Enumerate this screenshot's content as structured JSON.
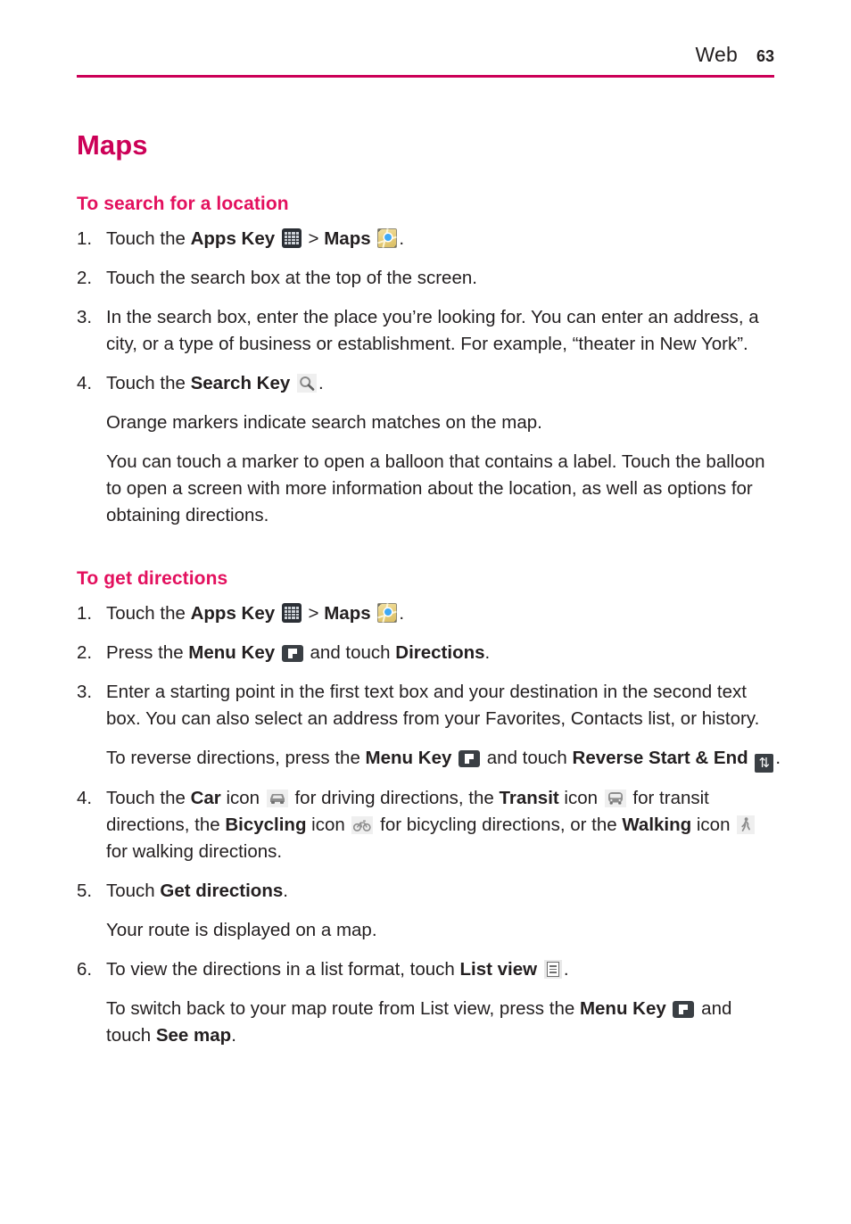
{
  "header": {
    "title": "Web",
    "page_number": "63",
    "rule_color": "#cc0057"
  },
  "colors": {
    "accent_magenta": "#cc0057",
    "subheading_magenta": "#e3105e",
    "body_text": "#231f20"
  },
  "section": {
    "title": "Maps"
  },
  "subsection_search": {
    "heading": "To search for a location",
    "steps": [
      {
        "num": "1.",
        "parts": [
          {
            "t": "Touch the "
          },
          {
            "t": "Apps Key",
            "b": true
          },
          {
            "t": " "
          },
          {
            "icon": "apps-key-icon"
          },
          {
            "t": " > "
          },
          {
            "t": "Maps",
            "b": true
          },
          {
            "t": " "
          },
          {
            "icon": "maps-app-icon"
          },
          {
            "t": "."
          }
        ]
      },
      {
        "num": "2.",
        "parts": [
          {
            "t": "Touch the search box at the top of the screen."
          }
        ]
      },
      {
        "num": "3.",
        "parts": [
          {
            "t": "In the search box, enter the place you’re looking for. You can enter an address, a city, or a type of business or establishment. For example, “theater in New York”."
          }
        ]
      },
      {
        "num": "4.",
        "parts": [
          {
            "t": "Touch the "
          },
          {
            "t": "Search Key",
            "b": true
          },
          {
            "t": " "
          },
          {
            "icon": "search-key-icon"
          },
          {
            "t": "."
          }
        ]
      }
    ],
    "note_1": "Orange markers indicate search matches on the map.",
    "note_2": "You can touch a marker to open a balloon that contains a label. Touch the balloon to open a screen with more information about the location, as well as options for obtaining directions."
  },
  "subsection_directions": {
    "heading": "To get directions",
    "steps": [
      {
        "num": "1.",
        "parts": [
          {
            "t": "Touch the "
          },
          {
            "t": "Apps Key",
            "b": true
          },
          {
            "t": " "
          },
          {
            "icon": "apps-key-icon"
          },
          {
            "t": " > "
          },
          {
            "t": "Maps",
            "b": true
          },
          {
            "t": " "
          },
          {
            "icon": "maps-app-icon"
          },
          {
            "t": "."
          }
        ]
      },
      {
        "num": "2.",
        "parts": [
          {
            "t": "Press the "
          },
          {
            "t": "Menu Key",
            "b": true
          },
          {
            "t": " "
          },
          {
            "icon": "menu-key-icon"
          },
          {
            "t": " and touch "
          },
          {
            "t": "Directions",
            "b": true
          },
          {
            "t": "."
          }
        ]
      },
      {
        "num": "3.",
        "parts": [
          {
            "t": "Enter a starting point in the first text box and your destination in the second text box. You can also select an address from your Favorites, Contacts list, or history."
          }
        ]
      },
      {
        "num": "4.",
        "parts": [
          {
            "t": "Touch the "
          },
          {
            "t": "Car",
            "b": true
          },
          {
            "t": " icon "
          },
          {
            "icon": "car-icon"
          },
          {
            "t": " for driving directions, the "
          },
          {
            "t": "Transit",
            "b": true
          },
          {
            "t": " icon "
          },
          {
            "icon": "transit-icon"
          },
          {
            "t": " for transit directions, the "
          },
          {
            "t": "Bicycling",
            "b": true
          },
          {
            "t": " icon "
          },
          {
            "icon": "bicycling-icon"
          },
          {
            "t": " for bicycling directions, or the "
          },
          {
            "t": "Walking",
            "b": true
          },
          {
            "t": " icon "
          },
          {
            "icon": "walking-icon"
          },
          {
            "t": " for walking directions."
          }
        ]
      },
      {
        "num": "5.",
        "parts": [
          {
            "t": "Touch "
          },
          {
            "t": "Get directions",
            "b": true
          },
          {
            "t": "."
          }
        ]
      },
      {
        "num": "6.",
        "parts": [
          {
            "t": "To view the directions in a list format, touch "
          },
          {
            "t": "List view",
            "b": true
          },
          {
            "t": " "
          },
          {
            "icon": "list-view-icon"
          },
          {
            "t": "."
          }
        ]
      }
    ],
    "note_reverse": [
      {
        "t": "To reverse directions, press the "
      },
      {
        "t": "Menu Key",
        "b": true
      },
      {
        "t": " "
      },
      {
        "icon": "menu-key-icon"
      },
      {
        "t": " and touch "
      },
      {
        "t": "Reverse Start & End",
        "b": true
      },
      {
        "t": " "
      },
      {
        "icon": "reverse-start-end-icon"
      },
      {
        "t": "."
      }
    ],
    "note_route": "Your route is displayed on a map.",
    "note_seemap": [
      {
        "t": "To switch back to your map route from List view, press the "
      },
      {
        "t": "Menu Key",
        "b": true
      },
      {
        "t": " "
      },
      {
        "icon": "menu-key-icon"
      },
      {
        "t": " and touch "
      },
      {
        "t": "See map",
        "b": true
      },
      {
        "t": "."
      }
    ]
  },
  "icons": {
    "reverse-start-end-icon": "⇅"
  }
}
